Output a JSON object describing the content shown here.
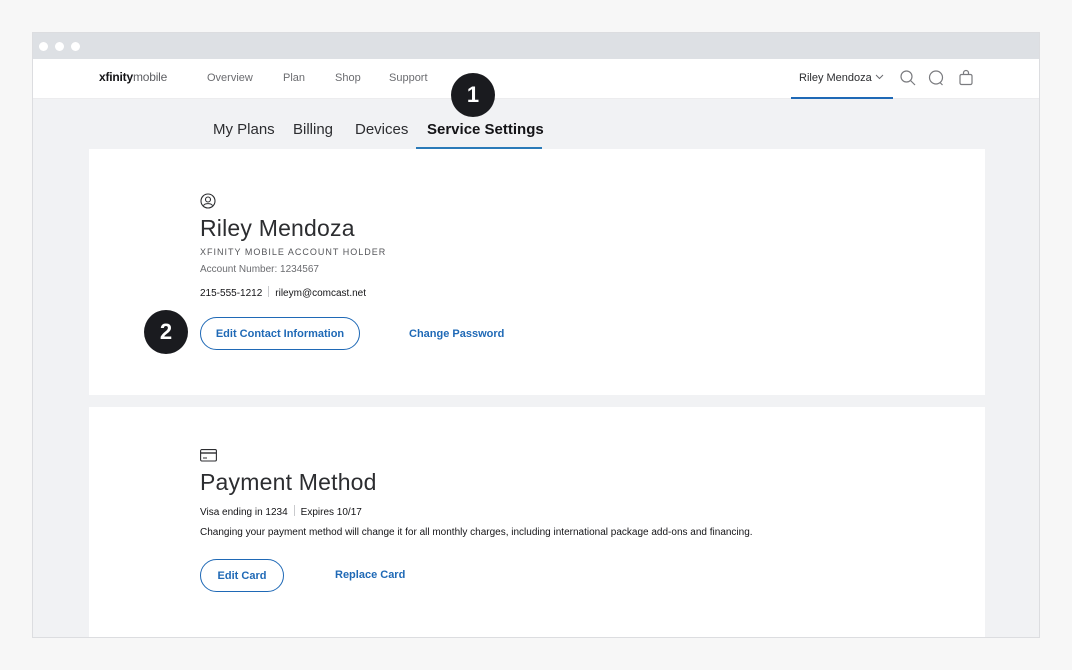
{
  "logo": {
    "brand": "xfinity",
    "product": "mobile"
  },
  "nav": {
    "items": [
      {
        "label": "Overview"
      },
      {
        "label": "Plan"
      },
      {
        "label": "Shop"
      },
      {
        "label": "Support"
      }
    ],
    "user_name": "Riley Mendoza",
    "icons": [
      "search-icon",
      "chat-icon",
      "shopping-bag-icon"
    ]
  },
  "tabs": [
    {
      "label": "My Plans",
      "active": false
    },
    {
      "label": "Billing",
      "active": false
    },
    {
      "label": "Devices",
      "active": false
    },
    {
      "label": "Service Settings",
      "active": true
    }
  ],
  "account": {
    "icon": "user-circle-icon",
    "name": "Riley Mendoza",
    "role": "XFINITY MOBILE ACCOUNT HOLDER",
    "account_number": "Account Number: 1234567",
    "phone": "215-555-1212",
    "email": "rileym@comcast.net",
    "edit_button": "Edit Contact Information",
    "change_password": "Change Password"
  },
  "payment": {
    "icon": "credit-card-icon",
    "title": "Payment Method",
    "card_ending": "Visa ending in 1234",
    "expires": "Expires 10/17",
    "note": "Changing your payment method will change it for all monthly charges, including international package add-ons and financing.",
    "edit_button": "Edit Card",
    "replace_link": "Replace Card"
  },
  "callouts": [
    {
      "label": "1"
    },
    {
      "label": "2"
    }
  ],
  "colors": {
    "accent": "#1f69b6",
    "page_bg": "#f1f2f4",
    "callout": "#1a1b1f"
  }
}
